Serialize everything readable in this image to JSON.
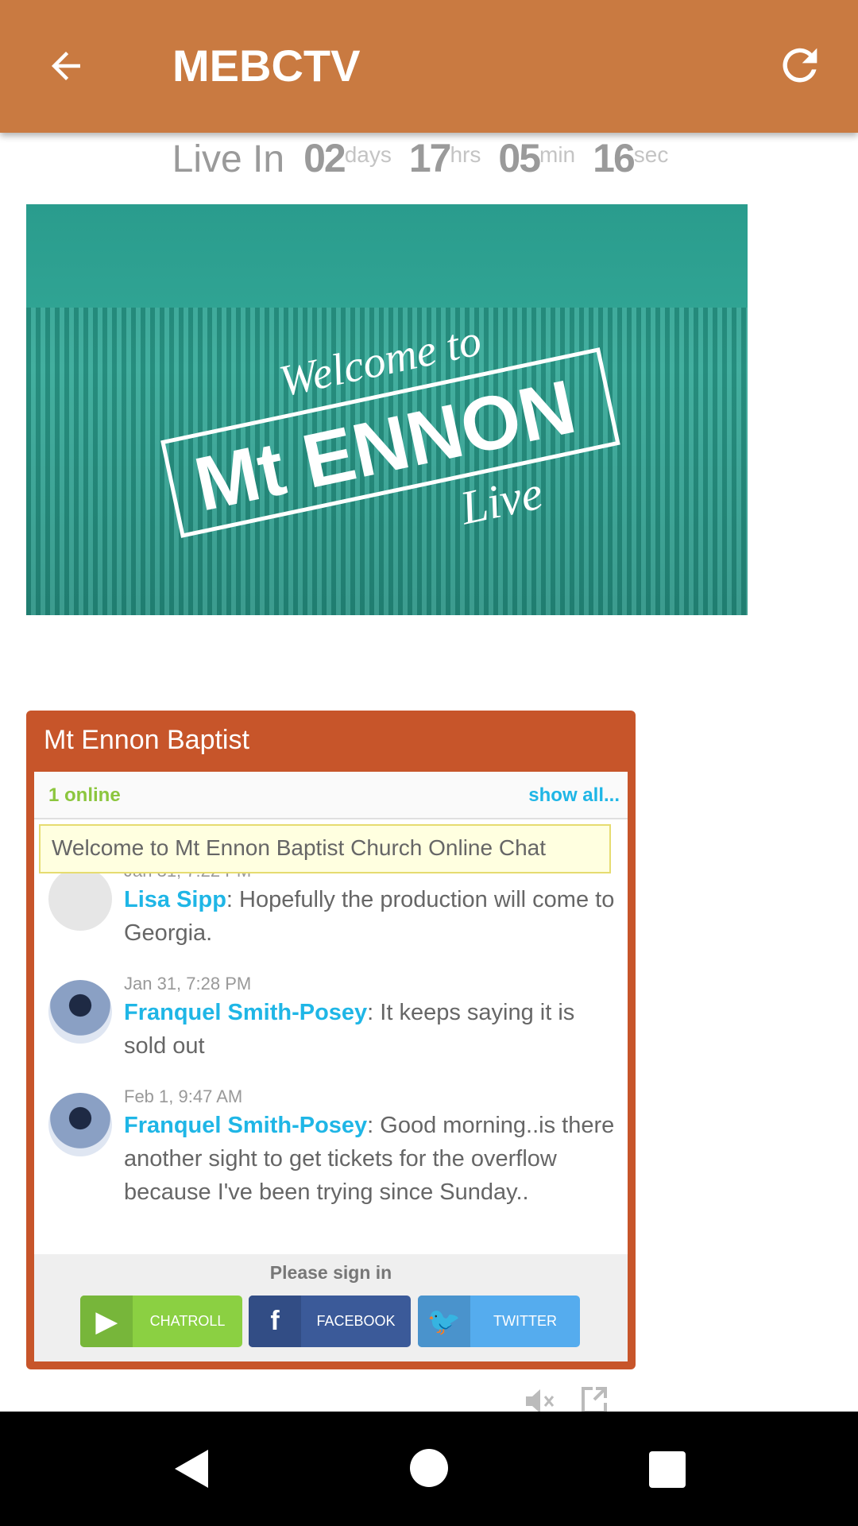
{
  "appbar": {
    "title": "MEBCTV",
    "back_icon": "arrow-left-icon",
    "refresh_icon": "refresh-icon",
    "color": "#c97a41"
  },
  "countdown": {
    "label": "Live In",
    "days": "02",
    "days_unit": "days",
    "hrs": "17",
    "hrs_unit": "hrs",
    "min": "05",
    "min_unit": "min",
    "sec": "16",
    "sec_unit": "sec"
  },
  "banner": {
    "line1": "Welcome to",
    "line2": "Mt ENNON",
    "line3": "Live"
  },
  "chat": {
    "title": "Mt Ennon Baptist",
    "online": "1 online",
    "show_all": "show all...",
    "welcome": "Welcome to Mt Ennon Baptist Church Online Chat",
    "messages": [
      {
        "time": "Jan 31, 7:22 PM",
        "name": "Lisa Sipp",
        "text": ": Hopefully the production will come to Georgia."
      },
      {
        "time": "Jan 31, 7:28 PM",
        "name": "Franquel Smith-Posey",
        "text": ": It keeps saying it is sold out"
      },
      {
        "time": "Feb 1, 9:47 AM",
        "name": "Franquel Smith-Posey",
        "text": ": Good morning..is there another sight to get tickets for the overflow because I've been trying since Sunday.."
      }
    ],
    "signin_label": "Please sign in",
    "buttons": [
      {
        "label": "CHATROLL",
        "color": "#8bd042"
      },
      {
        "label": "FACEBOOK",
        "color": "#3b5a99"
      },
      {
        "label": "TWITTER",
        "color": "#55acee"
      }
    ]
  },
  "controls": {
    "mute_icon": "volume-mute-icon",
    "popout_icon": "popout-icon"
  },
  "navbar": {
    "back": "nav-back-icon",
    "home": "nav-home-icon",
    "recents": "nav-recents-icon"
  }
}
